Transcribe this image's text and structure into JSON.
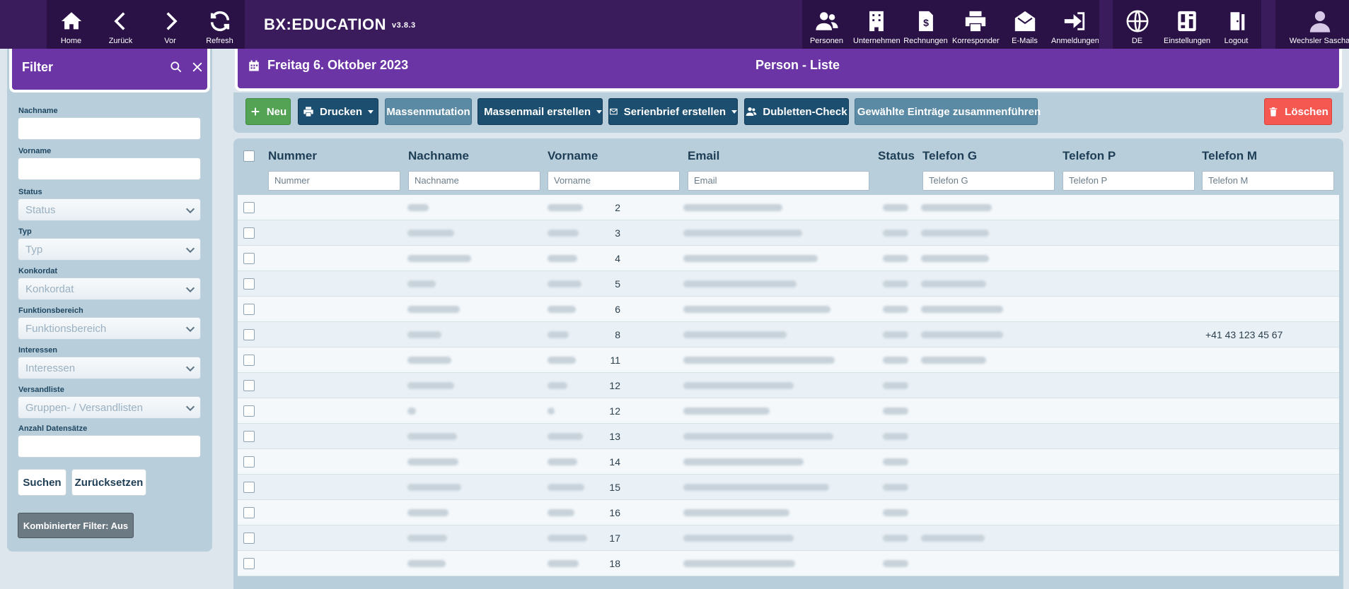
{
  "app": {
    "name": "BX:EDUCATION",
    "version": "v3.8.3"
  },
  "nav_left": [
    {
      "label": "Home",
      "icon": "home-icon"
    },
    {
      "label": "Zurück",
      "icon": "chevron-left-icon"
    },
    {
      "label": "Vor",
      "icon": "chevron-right-icon"
    },
    {
      "label": "Refresh",
      "icon": "refresh-icon"
    }
  ],
  "nav_right": [
    {
      "label": "Personen",
      "icon": "people-icon"
    },
    {
      "label": "Unternehmen",
      "icon": "building-icon"
    },
    {
      "label": "Rechnungen",
      "icon": "invoice-icon"
    },
    {
      "label": "Korrespondenz",
      "icon": "printer-icon"
    },
    {
      "label": "E-Mails",
      "icon": "mail-icon"
    },
    {
      "label": "Anmeldungen",
      "icon": "sign-in-icon"
    }
  ],
  "nav_extra": [
    {
      "label": "DE",
      "icon": "globe-icon"
    },
    {
      "label": "Einstellungen",
      "icon": "settings-icon"
    },
    {
      "label": "Logout",
      "icon": "logout-icon"
    },
    {
      "label": "Wechsler Sascha",
      "icon": "user-icon"
    }
  ],
  "filter": {
    "title": "Filter",
    "nachname_label": "Nachname",
    "vorname_label": "Vorname",
    "status_label": "Status",
    "status_placeholder": "Status",
    "typ_label": "Typ",
    "typ_placeholder": "Typ",
    "konkordat_label": "Konkordat",
    "konkordat_placeholder": "Konkordat",
    "funktionsbereich_label": "Funktionsbereich",
    "funktionsbereich_placeholder": "Funktionsbereich",
    "interessen_label": "Interessen",
    "interessen_placeholder": "Interessen",
    "versandliste_label": "Versandliste",
    "versandliste_placeholder": "Gruppen- / Versandlisten",
    "anzahl_label": "Anzahl Datensätze",
    "suchen": "Suchen",
    "zuruecksetzen": "Zurücksetzen",
    "kombiniert": "Kombinierter Filter: Aus"
  },
  "header": {
    "date": "Freitag 6. Oktober 2023",
    "title": "Person - Liste"
  },
  "toolbar": {
    "neu": "Neu",
    "drucken": "Drucken",
    "massenmutation": "Massenmutation",
    "massenmail": "Massenmail erstellen",
    "serienbrief": "Serienbrief erstellen",
    "dubletten": "Dubletten-Check",
    "zusammenfuehren": "Gewählte Einträge zusammenführen",
    "loeschen": "Löschen"
  },
  "table": {
    "columns": [
      "Nummer",
      "Nachname",
      "Vorname",
      "Email",
      "Status",
      "Telefon G",
      "Telefon P",
      "Telefon M"
    ],
    "filter_placeholders": {
      "nummer": "Nummer",
      "nachname": "Nachname",
      "vorname": "Vorname",
      "email": "Email",
      "telefon_g": "Telefon G",
      "telefon_p": "Telefon P",
      "telefon_m": "Telefon M"
    },
    "rows": [
      {
        "nummer": "2",
        "telefon_m": ""
      },
      {
        "nummer": "3",
        "telefon_m": ""
      },
      {
        "nummer": "4",
        "telefon_m": ""
      },
      {
        "nummer": "5",
        "telefon_m": ""
      },
      {
        "nummer": "6",
        "telefon_m": ""
      },
      {
        "nummer": "8",
        "telefon_m": "+41 43 123 45 67"
      },
      {
        "nummer": "11",
        "telefon_m": ""
      },
      {
        "nummer": "12",
        "telefon_m": ""
      },
      {
        "nummer": "12",
        "telefon_m": ""
      },
      {
        "nummer": "13",
        "telefon_m": ""
      },
      {
        "nummer": "14",
        "telefon_m": ""
      },
      {
        "nummer": "15",
        "telefon_m": ""
      },
      {
        "nummer": "16",
        "telefon_m": ""
      },
      {
        "nummer": "17",
        "telefon_m": ""
      },
      {
        "nummer": "18",
        "telefon_m": ""
      }
    ]
  },
  "colors": {
    "topbar": "#3a1b5c",
    "accent_purple": "#6b35a6",
    "panel": "#b9cedb",
    "button_dark": "#1c4e70",
    "button_slate": "#5b8aa5",
    "button_green": "#54a253",
    "button_red": "#f55850"
  }
}
